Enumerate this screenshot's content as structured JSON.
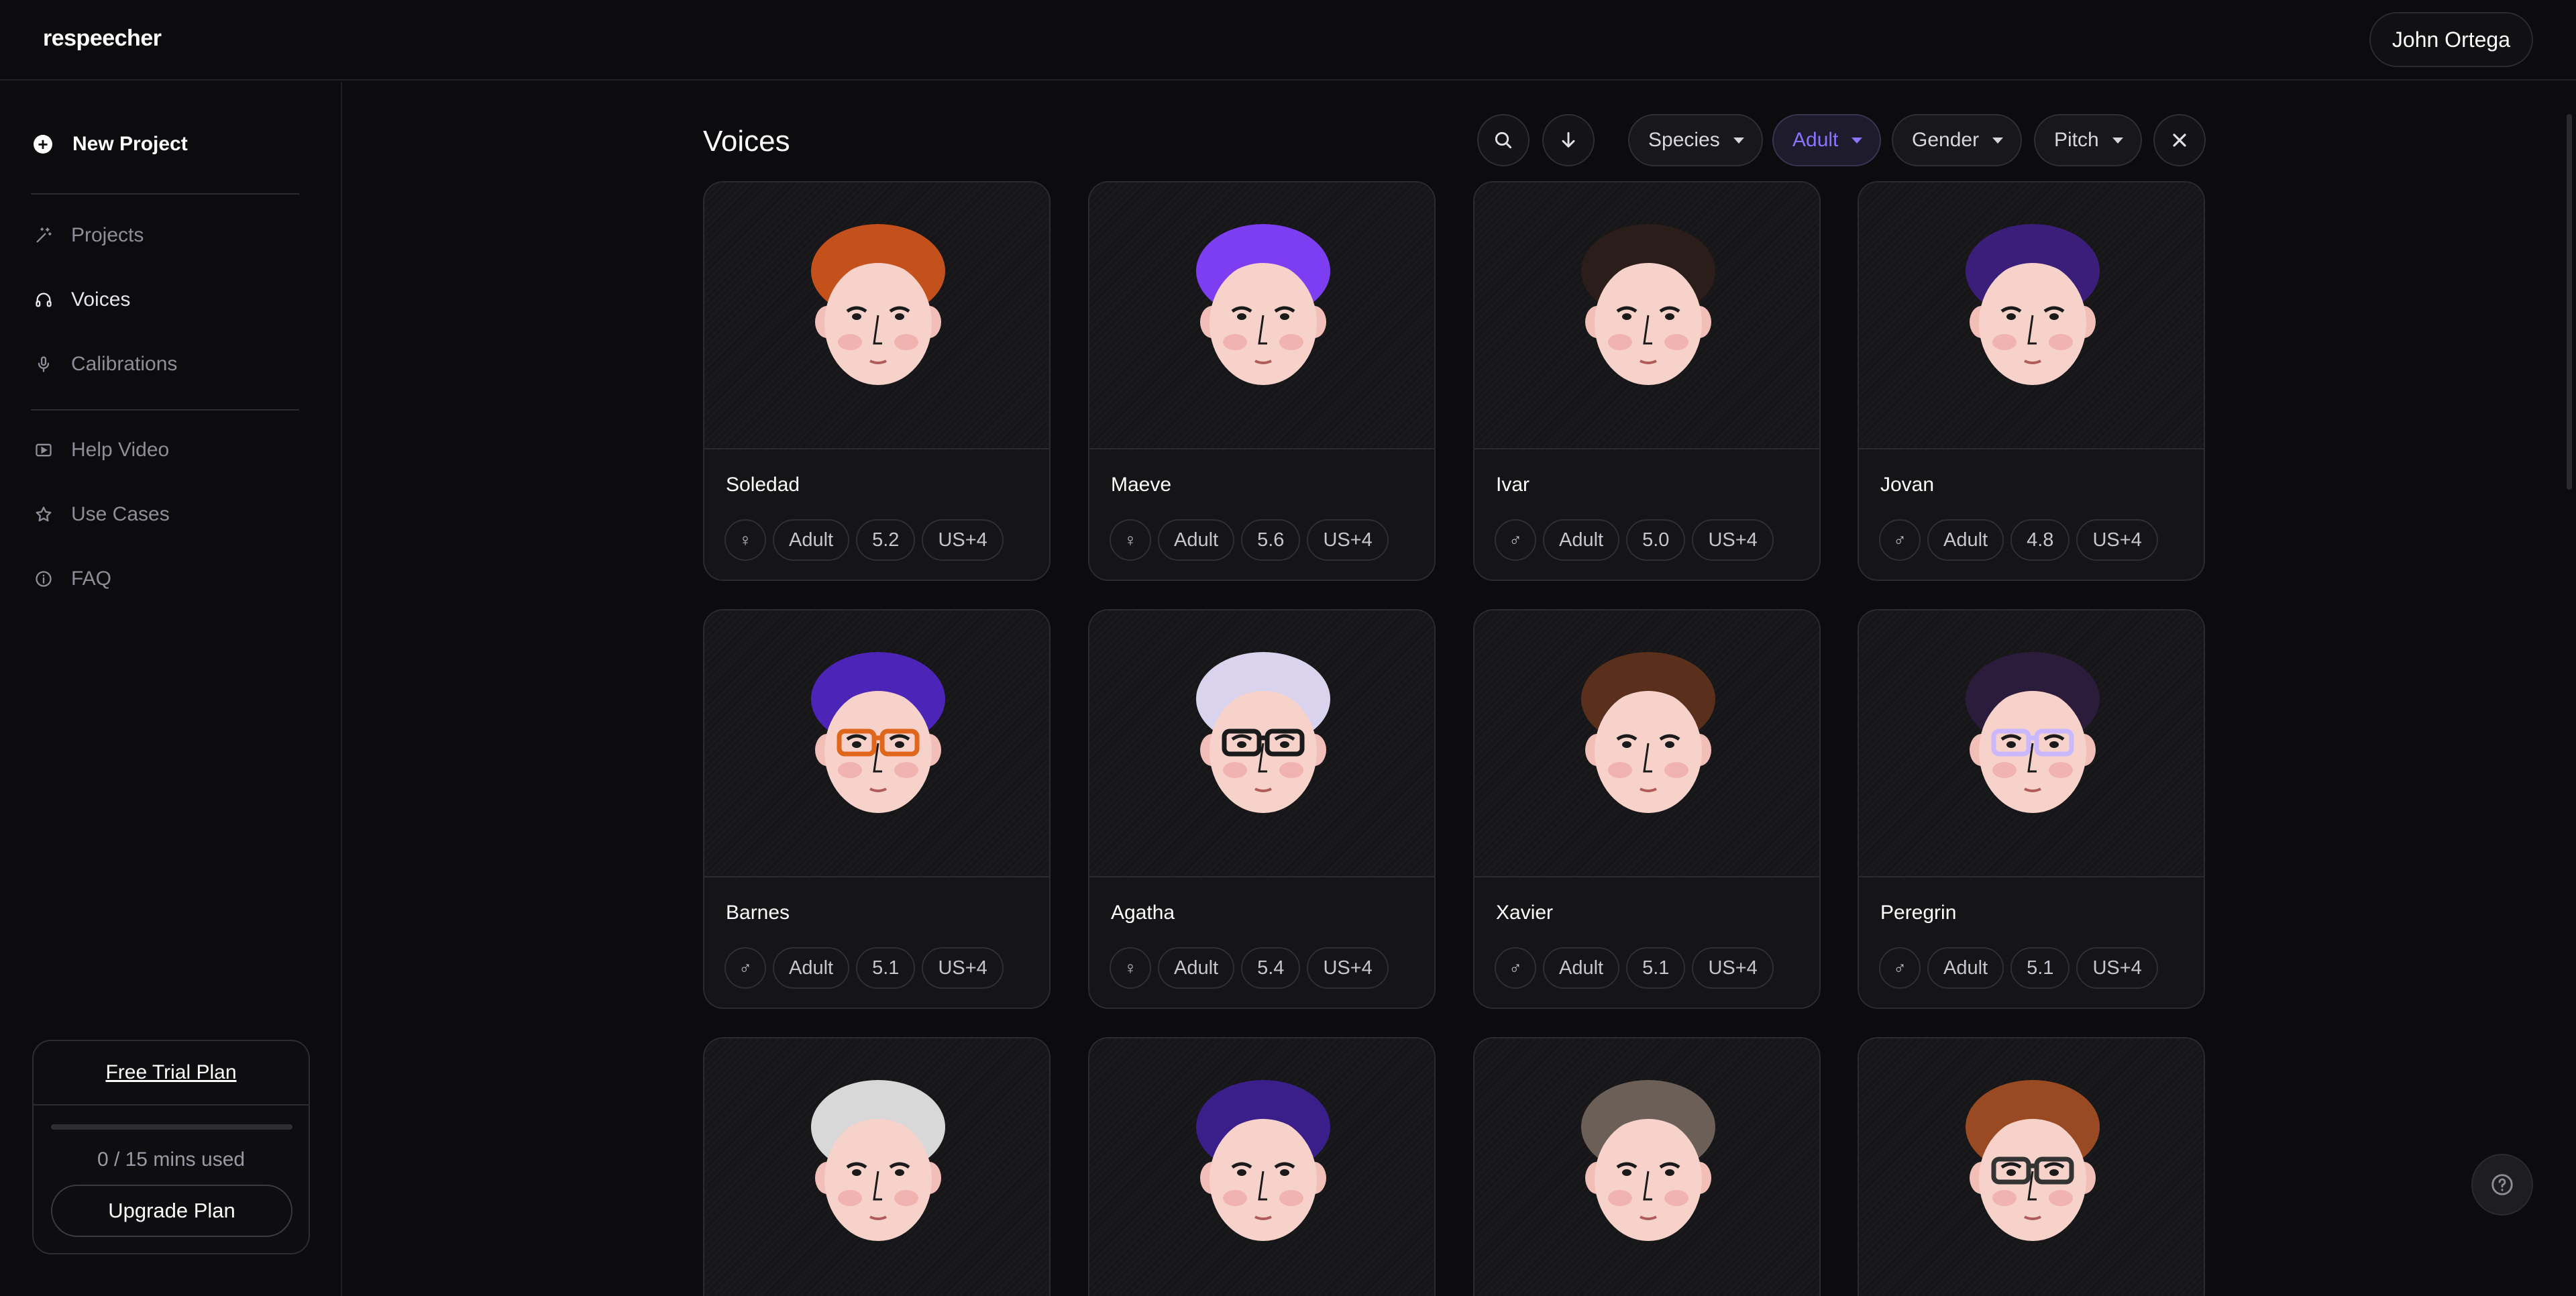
{
  "app": {
    "logo": "respeecher",
    "user_name": "John Ortega"
  },
  "sidebar": {
    "new_project": "New Project",
    "group1": [
      {
        "label": "Projects",
        "icon": "magic-wand-icon"
      },
      {
        "label": "Voices",
        "icon": "headphones-icon",
        "active": true
      },
      {
        "label": "Calibrations",
        "icon": "microphone-icon"
      }
    ],
    "group2": [
      {
        "label": "Help Video",
        "icon": "video-icon"
      },
      {
        "label": "Use Cases",
        "icon": "star-icon"
      },
      {
        "label": "FAQ",
        "icon": "info-icon"
      }
    ],
    "plan": {
      "title": "Free Trial Plan",
      "usage": "0 / 15 mins used",
      "usage_fraction": 0,
      "upgrade": "Upgrade Plan"
    }
  },
  "main": {
    "title": "Voices",
    "filters": [
      {
        "label": "Species",
        "active": false
      },
      {
        "label": "Adult",
        "active": true
      },
      {
        "label": "Gender",
        "active": false
      },
      {
        "label": "Pitch",
        "active": false
      }
    ],
    "voices": [
      {
        "name": "Soledad",
        "gender": "♀",
        "age": "Adult",
        "pitch": "5.2",
        "accent": "US+4",
        "hair": "#c4511c",
        "glasses": ""
      },
      {
        "name": "Maeve",
        "gender": "♀",
        "age": "Adult",
        "pitch": "5.6",
        "accent": "US+4",
        "hair": "#7d3df0",
        "glasses": ""
      },
      {
        "name": "Ivar",
        "gender": "♂",
        "age": "Adult",
        "pitch": "5.0",
        "accent": "US+4",
        "hair": "#2a1d1a",
        "glasses": ""
      },
      {
        "name": "Jovan",
        "gender": "♂",
        "age": "Adult",
        "pitch": "4.8",
        "accent": "US+4",
        "hair": "#3a1e7a",
        "glasses": ""
      },
      {
        "name": "Barnes",
        "gender": "♂",
        "age": "Adult",
        "pitch": "5.1",
        "accent": "US+4",
        "hair": "#4c24b8",
        "glasses": "#e0661c"
      },
      {
        "name": "Agatha",
        "gender": "♀",
        "age": "Adult",
        "pitch": "5.4",
        "accent": "US+4",
        "hair": "#d9d3ee",
        "glasses": "#1a1a1a"
      },
      {
        "name": "Xavier",
        "gender": "♂",
        "age": "Adult",
        "pitch": "5.1",
        "accent": "US+4",
        "hair": "#5a2f1c",
        "glasses": ""
      },
      {
        "name": "Peregrin",
        "gender": "♂",
        "age": "Adult",
        "pitch": "5.1",
        "accent": "US+4",
        "hair": "#2c1c3c",
        "glasses": "#c9b8ff"
      },
      {
        "name": "",
        "hair": "#d8d8d8",
        "glasses": ""
      },
      {
        "name": "",
        "hair": "#3a1e8a",
        "glasses": ""
      },
      {
        "name": "",
        "hair": "#6b5f58",
        "glasses": ""
      },
      {
        "name": "",
        "hair": "#9a4a22",
        "glasses": "#333333"
      }
    ]
  },
  "colors": {
    "accent": "#8c73ff",
    "background": "#0c0c0e",
    "card": "#151518"
  }
}
